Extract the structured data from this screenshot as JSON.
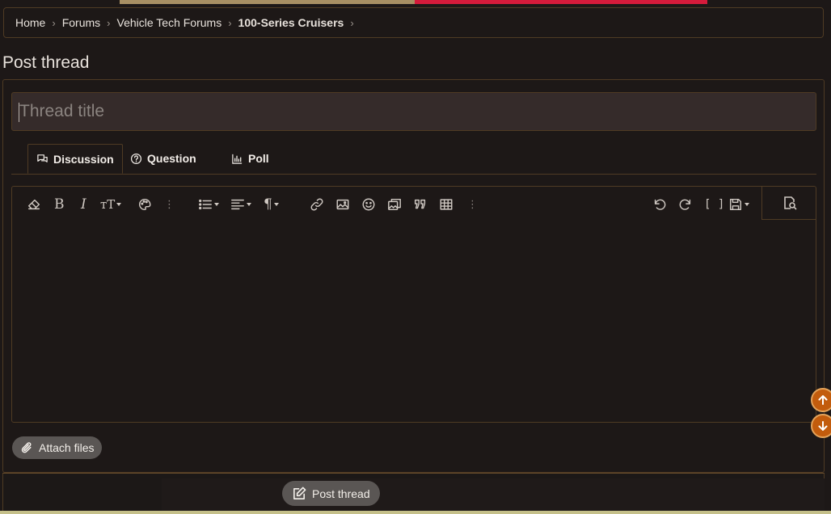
{
  "breadcrumb": {
    "items": [
      "Home",
      "Forums",
      "Vehicle Tech Forums",
      "100-Series Cruisers"
    ],
    "separator": "›"
  },
  "page": {
    "title": "Post thread"
  },
  "form": {
    "title_placeholder": "Thread title",
    "title_value": "",
    "tabs": [
      {
        "label": "Discussion",
        "icon": "discussion-icon",
        "active": true
      },
      {
        "label": "Question",
        "icon": "question-icon",
        "active": false
      },
      {
        "label": "Poll",
        "icon": "poll-icon",
        "active": false
      }
    ],
    "editor": {
      "toolbar_left": [
        "eraser-icon",
        "bold-icon",
        "italic-icon",
        "text-size-icon",
        "palette-icon",
        "more-options-icon",
        "list-icon",
        "align-icon",
        "paragraph-icon",
        "link-icon",
        "image-icon",
        "smilie-icon",
        "media-icon",
        "quote-icon",
        "table-icon",
        "more-options-icon"
      ],
      "toolbar_right": [
        "undo-icon",
        "redo-icon",
        "bbcode-toggle-icon",
        "drafts-icon",
        "preview-icon"
      ],
      "glyphs": {
        "bold": "B",
        "italic": "I",
        "text_size": "тT",
        "paragraph": "¶",
        "brackets": "[ ]"
      },
      "content": ""
    },
    "attach_label": "Attach files",
    "submit_label": "Post thread"
  },
  "colors": {
    "background": "#1d1817",
    "border": "#4f3b24",
    "input_bg": "#352b2a",
    "button_bg": "#5a5654",
    "scroll_btn": "#c25c0d",
    "banner_red": "#d51b3b"
  },
  "scroll_buttons": [
    "arrow-up-icon",
    "arrow-down-icon"
  ]
}
